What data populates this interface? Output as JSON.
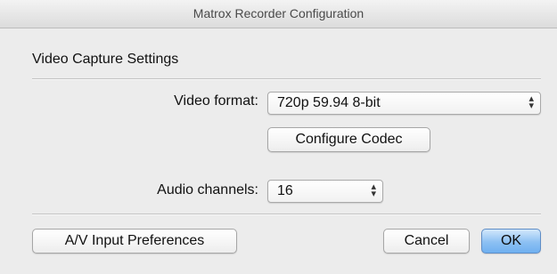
{
  "window": {
    "title": "Matrox Recorder Configuration"
  },
  "section": {
    "title": "Video Capture Settings"
  },
  "video_format": {
    "label": "Video format:",
    "value": "720p 59.94 8-bit",
    "arrows_icon": "up-down-arrows-icon"
  },
  "configure_codec": {
    "label": "Configure Codec"
  },
  "audio_channels": {
    "label": "Audio channels:",
    "value": "16",
    "arrows_icon": "up-down-arrows-icon"
  },
  "footer": {
    "av_prefs_label": "A/V Input Preferences",
    "cancel_label": "Cancel",
    "ok_label": "OK"
  },
  "colors": {
    "default_button": "#8cc0f3",
    "window_bg": "#ececec"
  }
}
